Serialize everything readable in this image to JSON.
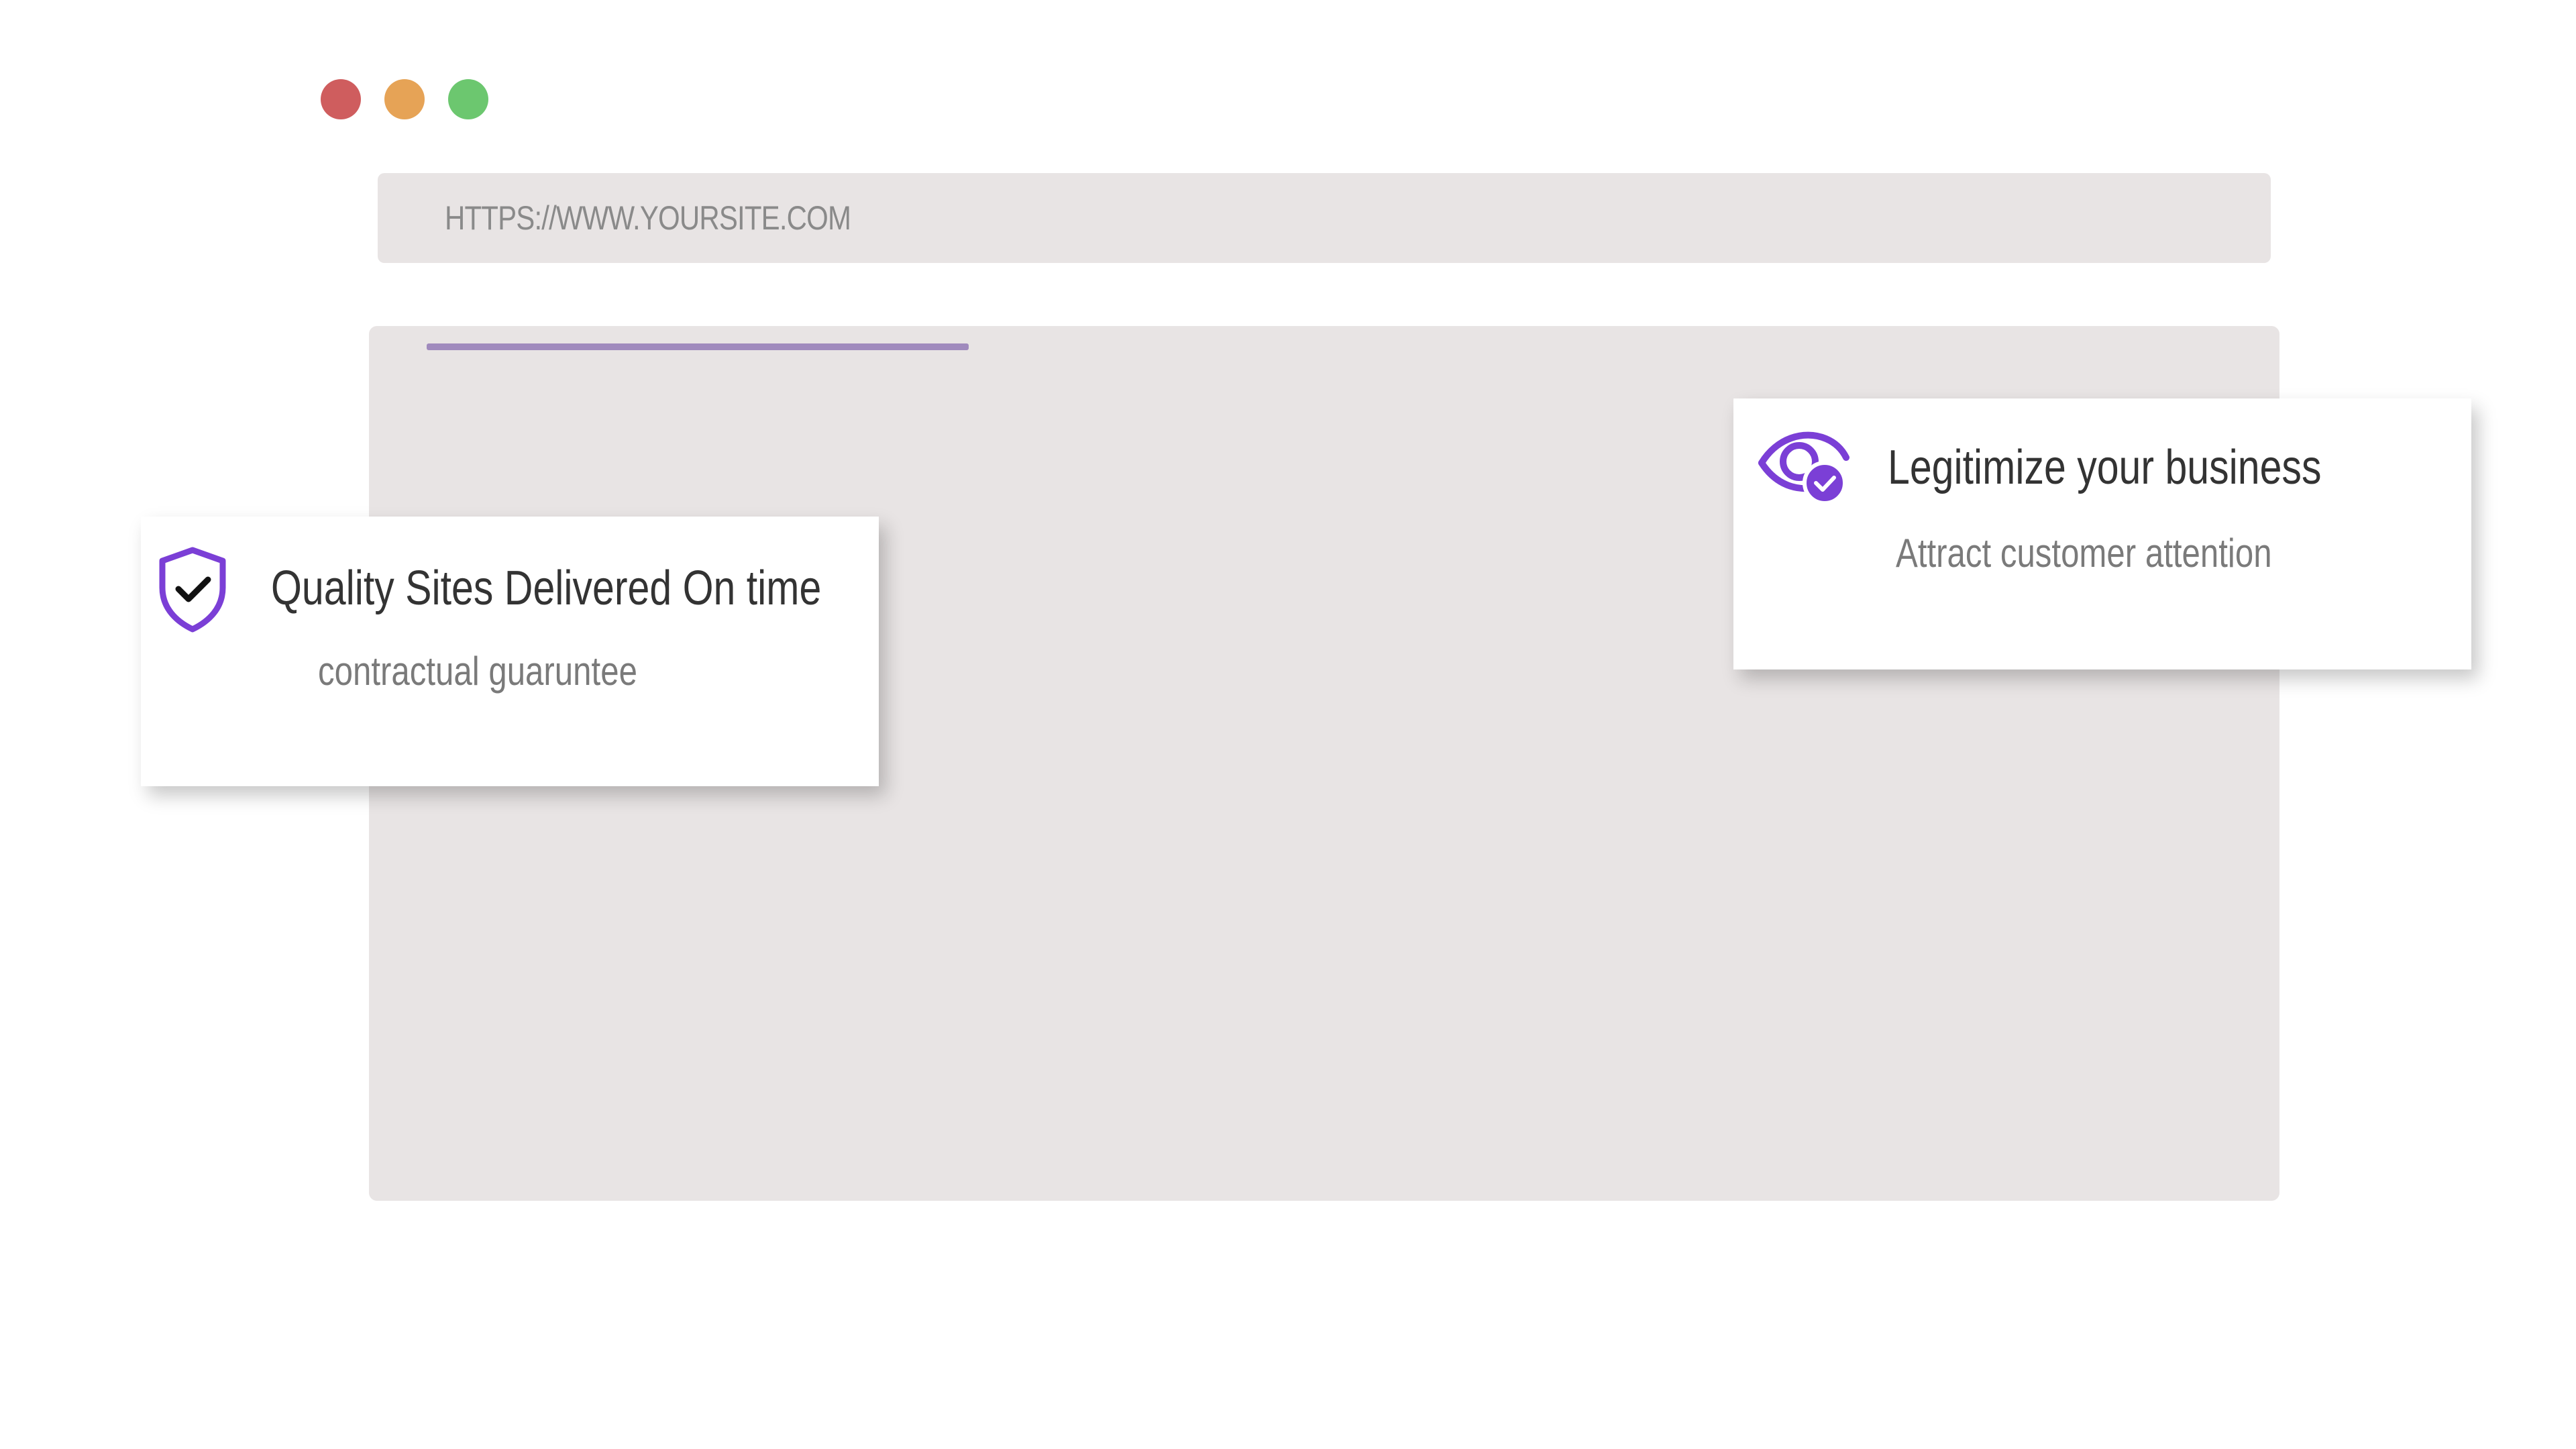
{
  "window_controls": {
    "close_color": "#cf5d5e",
    "minimize_color": "#e6a356",
    "maximize_color": "#6cc76f"
  },
  "address_bar": {
    "url": "HTTPS://WWW.YOURSITE.COM"
  },
  "content": {
    "loading_progress": 0.53,
    "accent_color": "#a08abd"
  },
  "cards": {
    "quality": {
      "icon": "shield-check-icon",
      "title": "Quality Sites Delivered On time",
      "subtitle": "contractual guaruntee"
    },
    "legitimize": {
      "icon": "eye-check-icon",
      "title": "Legitimize your business",
      "subtitle": "Attract customer attention"
    }
  },
  "brand_color": "#7b3fd6"
}
